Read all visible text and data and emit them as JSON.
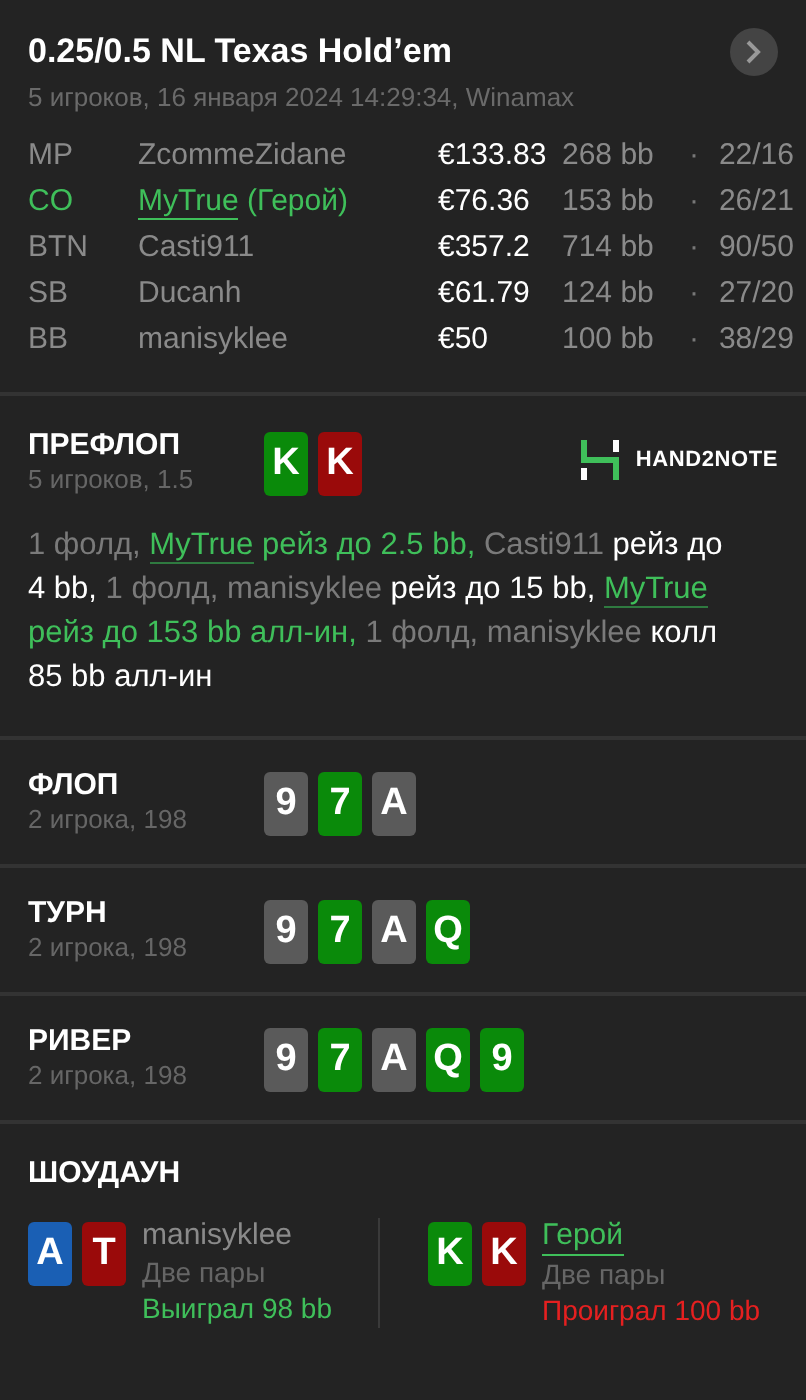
{
  "header": {
    "title": "0.25/0.5 NL Texas Hold’em",
    "subtitle": "5 игроков, 16 января 2024 14:29:34, Winamax"
  },
  "players": [
    {
      "position": "MP",
      "name": "ZcommeZidane",
      "hero": false,
      "stack": "€133.83",
      "bb": "268 bb",
      "separator": "·",
      "stats": "22/16"
    },
    {
      "position": "CO",
      "name": "MyTrue",
      "hero_label": "(Герой)",
      "hero": true,
      "stack": "€76.36",
      "bb": "153 bb",
      "separator": "·",
      "stats": "26/21"
    },
    {
      "position": "BTN",
      "name": "Casti911",
      "hero": false,
      "stack": "€357.2",
      "bb": "714 bb",
      "separator": "·",
      "stats": "90/50"
    },
    {
      "position": "SB",
      "name": "Ducanh",
      "hero": false,
      "stack": "€61.79",
      "bb": "124 bb",
      "separator": "·",
      "stats": "27/20"
    },
    {
      "position": "BB",
      "name": "manisyklee",
      "hero": false,
      "stack": "€50",
      "bb": "100 bb",
      "separator": "·",
      "stats": "38/29"
    }
  ],
  "streets": [
    {
      "title": "ПРЕФЛОП",
      "info": "5 игроков, 1.5",
      "cards": [
        {
          "rank": "K",
          "color": "#0a8a0a"
        },
        {
          "rank": "K",
          "color": "#9a0a0a"
        }
      ],
      "logo": {
        "text": "HAND2NOTE"
      },
      "actions": [
        {
          "kind": "muted",
          "text": "1 фолд, "
        },
        {
          "kind": "hero",
          "text": "MyTrue"
        },
        {
          "kind": "green",
          "text": " рейз до 2.5 bb, "
        },
        {
          "kind": "muted",
          "text": "Casti911 "
        },
        {
          "kind": "plain",
          "text": "рейз до 4 bb, "
        },
        {
          "kind": "muted",
          "text": "1 фолд, manisyklee "
        },
        {
          "kind": "plain",
          "text": "рейз до 15 bb, "
        },
        {
          "kind": "hero",
          "text": "MyTrue"
        },
        {
          "kind": "green",
          "text": " рейз до 153 bb алл-ин, "
        },
        {
          "kind": "muted",
          "text": "1 фолд, manisyklee "
        },
        {
          "kind": "plain",
          "text": "колл 85 bb алл-ин"
        }
      ]
    },
    {
      "title": "ФЛОП",
      "info": "2 игрока, 198",
      "cards": [
        {
          "rank": "9",
          "color": "#5a5a5a"
        },
        {
          "rank": "7",
          "color": "#0a8a0a"
        },
        {
          "rank": "A",
          "color": "#5a5a5a"
        }
      ]
    },
    {
      "title": "ТУРН",
      "info": "2 игрока, 198",
      "cards": [
        {
          "rank": "9",
          "color": "#5a5a5a"
        },
        {
          "rank": "7",
          "color": "#0a8a0a"
        },
        {
          "rank": "A",
          "color": "#5a5a5a"
        },
        {
          "rank": "Q",
          "color": "#0a8a0a"
        }
      ]
    },
    {
      "title": "РИВЕР",
      "info": "2 игрока, 198",
      "cards": [
        {
          "rank": "9",
          "color": "#5a5a5a"
        },
        {
          "rank": "7",
          "color": "#0a8a0a"
        },
        {
          "rank": "A",
          "color": "#5a5a5a"
        },
        {
          "rank": "Q",
          "color": "#0a8a0a"
        },
        {
          "rank": "9",
          "color": "#0a8a0a"
        }
      ]
    }
  ],
  "showdown": {
    "title": "ШОУДАУН",
    "players": [
      {
        "name": "manisyklee",
        "hero": false,
        "hand": "Две пары",
        "result": "Выиграл 98 bb",
        "won": true,
        "cards": [
          {
            "rank": "A",
            "color": "#1a5fb4"
          },
          {
            "rank": "T",
            "color": "#9a0a0a"
          }
        ]
      },
      {
        "name": "Герой",
        "hero": true,
        "hand": "Две пары",
        "result": "Проиграл 100 bb",
        "won": false,
        "cards": [
          {
            "rank": "K",
            "color": "#0a8a0a"
          },
          {
            "rank": "K",
            "color": "#9a0a0a"
          }
        ]
      }
    ]
  }
}
